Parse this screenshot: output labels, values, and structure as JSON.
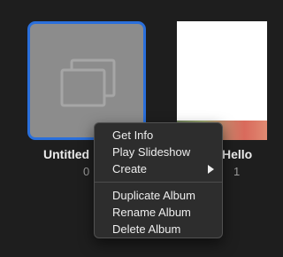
{
  "albums": [
    {
      "title": "Untitled",
      "count": "0"
    },
    {
      "title": "Hello",
      "count": "1"
    }
  ],
  "context_menu": {
    "items": [
      {
        "label": "Get Info"
      },
      {
        "label": "Play Slideshow"
      },
      {
        "label": "Create",
        "has_submenu": true
      },
      {
        "label": "Duplicate Album"
      },
      {
        "label": "Rename Album"
      },
      {
        "label": "Delete Album"
      }
    ]
  },
  "colors": {
    "background": "#1e1e1e",
    "selection_border": "#2a6fdb",
    "placeholder_fill": "#8c8c8c",
    "menu_background": "#2d2d2d"
  },
  "icons": {
    "placeholder": "album-placeholder-icon",
    "submenu": "chevron-right-icon"
  }
}
